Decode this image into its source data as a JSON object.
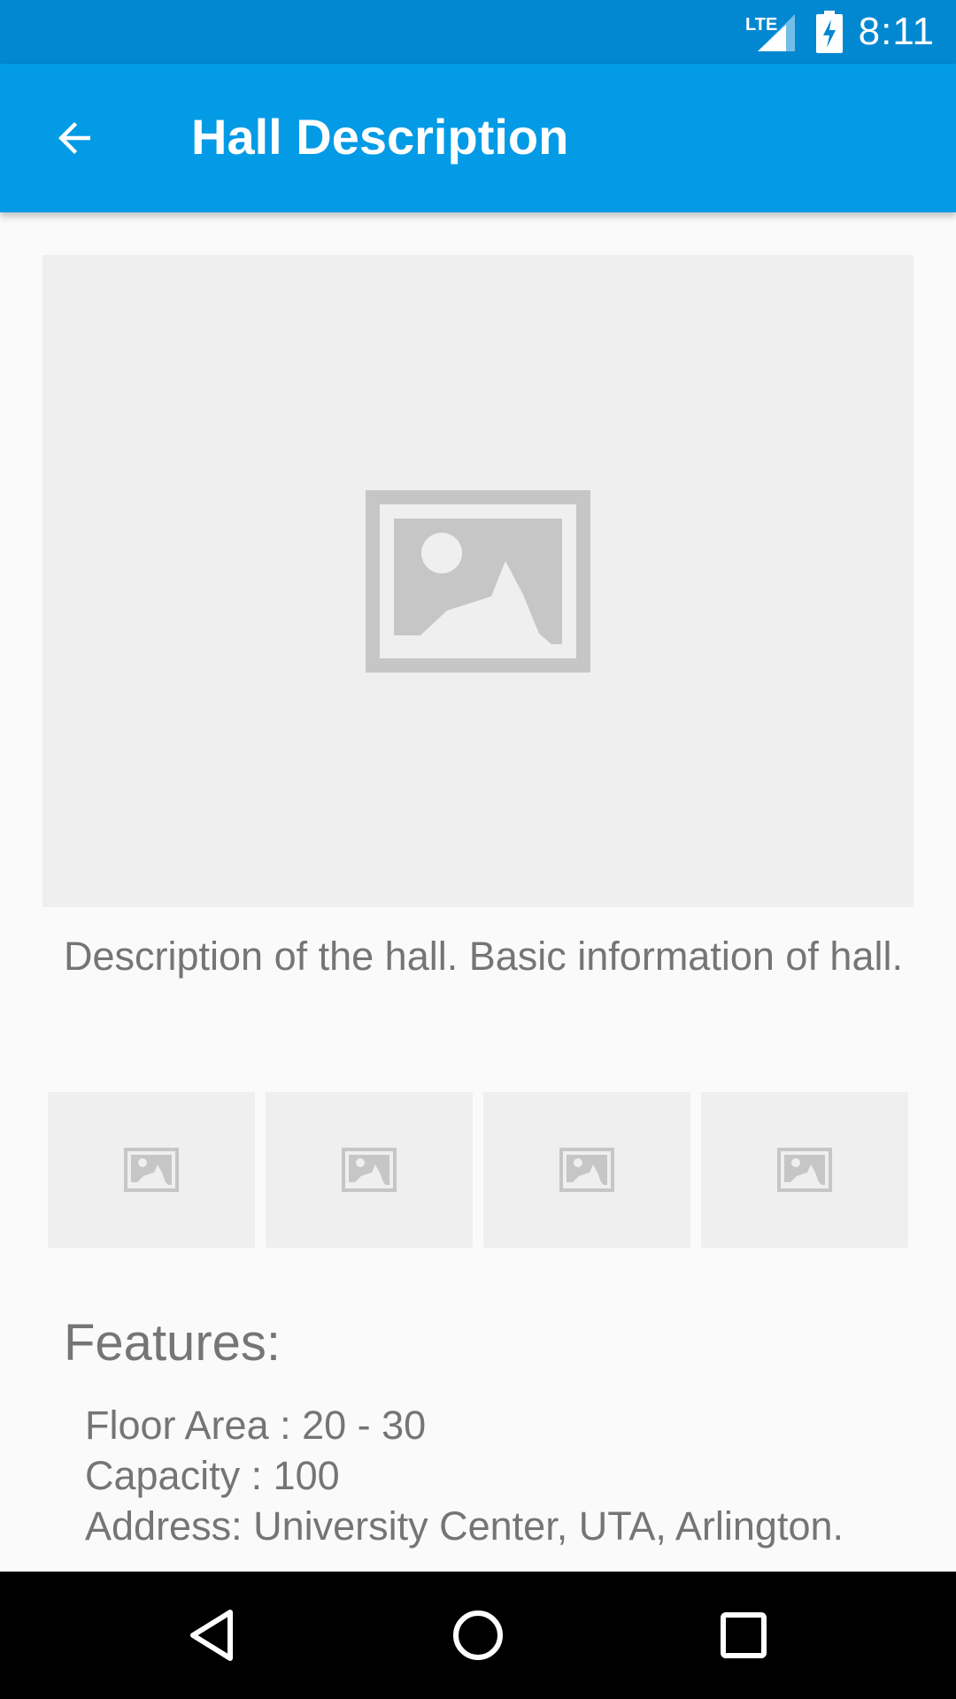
{
  "status_bar": {
    "network_label": "LTE",
    "time": "8:11",
    "icons": [
      "signal-lte-icon",
      "battery-charging-icon"
    ]
  },
  "app_bar": {
    "title": "Hall Description",
    "back_icon": "arrow-back-icon"
  },
  "main": {
    "main_image_icon": "image-placeholder-icon",
    "description": "Description of the hall. Basic information of hall.",
    "thumbnails": [
      {
        "icon": "image-placeholder-icon"
      },
      {
        "icon": "image-placeholder-icon"
      },
      {
        "icon": "image-placeholder-icon"
      },
      {
        "icon": "image-placeholder-icon"
      }
    ],
    "features_heading": "Features:",
    "features": [
      "Floor Area : 20 - 30",
      "Capacity : 100",
      "Address: University Center, UTA, Arlington."
    ]
  },
  "nav_bar": {
    "icons": [
      "nav-back-icon",
      "nav-home-icon",
      "nav-recents-icon"
    ]
  },
  "colors": {
    "status_bar": "#0288d1",
    "app_bar": "#039be5",
    "background": "#fafafa",
    "placeholder_bg": "#f0eff0",
    "placeholder_icon": "#c6c6c6",
    "text": "#757575"
  }
}
